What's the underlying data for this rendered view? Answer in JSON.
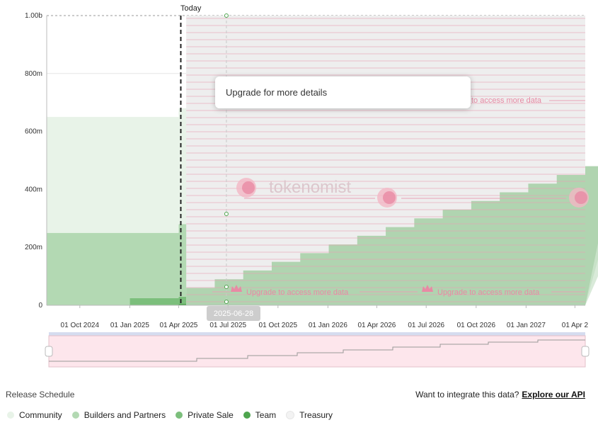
{
  "today_label": "Today",
  "tooltip_text": "Upgrade for more details",
  "hover_date": "2025-06-28",
  "watermark": {
    "brand": "tokenomist",
    "upgrade_full": "Upgrade to access more data",
    "upgrade_partial": "to access more data"
  },
  "footer": {
    "left": "Release Schedule",
    "question": "Want to integrate this data?",
    "link": "Explore our API"
  },
  "legend": [
    {
      "name": "Community",
      "color": "#e8f3e8"
    },
    {
      "name": "Builders and Partners",
      "color": "#b3d9b3"
    },
    {
      "name": "Private Sale",
      "color": "#7cbf7c"
    },
    {
      "name": "Team",
      "color": "#4ea54e"
    },
    {
      "name": "Treasury",
      "color": "#f3f3f3"
    }
  ],
  "chart_data": {
    "type": "area",
    "y_tick_labels": [
      "0",
      "200m",
      "400m",
      "600m",
      "800m",
      "1.00b"
    ],
    "ylim": [
      0,
      1000
    ],
    "x_tick_labels": [
      "01 Oct 2024",
      "01 Jan 2025",
      "01 Apr 2025",
      "01 Jul 2025",
      "01 Oct 2025",
      "01 Jan 2026",
      "01 Apr 2026",
      "01 Jul 2026",
      "01 Oct 2026",
      "01 Jan 2027",
      "01 Apr 2"
    ],
    "today_date": "2025-04-05",
    "locked_from": "2025-04-15",
    "stack": [
      {
        "name": "Team",
        "x": [
          "2024-08-01",
          "2025-01-01",
          "2025-04-01",
          "2025-07-01"
        ],
        "values": [
          0,
          0,
          5,
          10
        ]
      },
      {
        "name": "Private Sale",
        "x": [
          "2024-08-01",
          "2025-01-01",
          "2025-04-01",
          "2025-07-01"
        ],
        "values": [
          0,
          25,
          25,
          40
        ]
      },
      {
        "name": "Builders and Partners",
        "x": [
          "2024-08-01",
          "2025-01-01",
          "2025-04-01",
          "2025-07-01"
        ],
        "values": [
          250,
          225,
          250,
          255
        ]
      },
      {
        "name": "Community",
        "x": [
          "2024-08-01",
          "2025-01-01",
          "2025-04-01",
          "2025-07-01"
        ],
        "values": [
          400,
          400,
          400,
          405
        ]
      },
      {
        "name": "Treasury",
        "x": [
          "2024-08-01",
          "2025-01-01",
          "2025-04-01",
          "2025-07-01"
        ],
        "values": [
          0,
          0,
          0,
          0
        ]
      }
    ],
    "max_supply": 1000
  }
}
